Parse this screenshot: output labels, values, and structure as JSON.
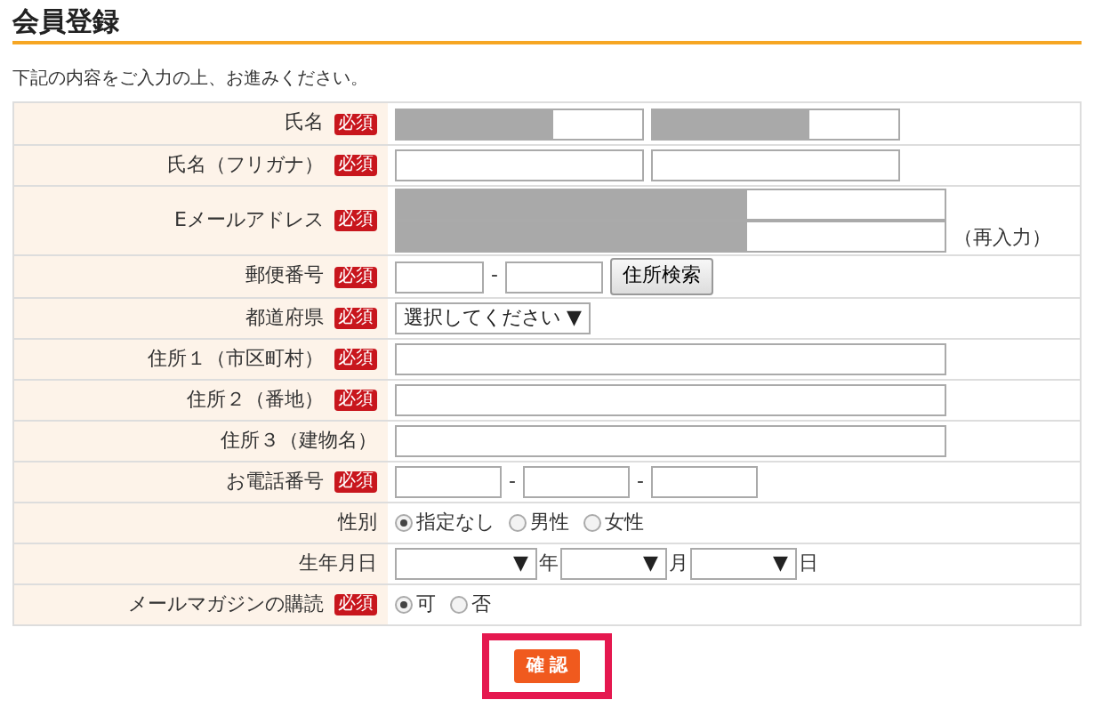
{
  "title": "会員登録",
  "intro": "下記の内容をご入力の上、お進みください。",
  "rows": [
    {
      "kind": "pair",
      "label": "氏名",
      "badge": "必須",
      "fields": [
        {
          "masked": true
        },
        {
          "masked": true
        }
      ]
    },
    {
      "kind": "pair",
      "label": "氏名（フリガナ）",
      "badge": "必須",
      "fields": [
        {
          "masked": false
        },
        {
          "masked": false
        }
      ]
    },
    {
      "kind": "email",
      "label": "Eメールアドレス",
      "badge": "必須",
      "fields": [
        {
          "masked": true
        },
        {
          "masked": true
        }
      ],
      "note": "（再入力）"
    },
    {
      "kind": "postal",
      "label": "郵便番号",
      "badge": "必須",
      "fields": [
        {
          "masked": false
        },
        {
          "masked": false
        }
      ],
      "separator": "-",
      "button": "住所検索"
    },
    {
      "kind": "select",
      "label": "都道府県",
      "badge": "必須",
      "value": "選択してください",
      "caret": "▼"
    },
    {
      "kind": "text",
      "label": "住所１（市区町村）",
      "badge": "必須",
      "fields": [
        {
          "masked": false
        }
      ]
    },
    {
      "kind": "text",
      "label": "住所２（番地）",
      "badge": "必須",
      "fields": [
        {
          "masked": false
        }
      ]
    },
    {
      "kind": "text",
      "label": "住所３（建物名）",
      "fields": [
        {
          "masked": false
        }
      ]
    },
    {
      "kind": "phone",
      "label": "お電話番号",
      "badge": "必須",
      "fields": [
        {
          "masked": false
        },
        {
          "masked": false
        },
        {
          "masked": false
        }
      ],
      "separator": "-"
    },
    {
      "kind": "radio",
      "label": "性別",
      "options": [
        {
          "label": "指定なし",
          "selected": true
        },
        {
          "label": "男性",
          "selected": false
        },
        {
          "label": "女性",
          "selected": false
        }
      ]
    },
    {
      "kind": "date",
      "label": "生年月日",
      "selects": [
        {
          "caret": "▼",
          "unit": "年"
        },
        {
          "caret": "▼",
          "unit": "月"
        },
        {
          "caret": "▼",
          "unit": "日"
        }
      ]
    },
    {
      "kind": "radio",
      "label": "メールマガジンの購読",
      "badge": "必須",
      "options": [
        {
          "label": "可",
          "selected": true
        },
        {
          "label": "否",
          "selected": false
        }
      ]
    }
  ],
  "submit": {
    "label": "確 認",
    "highlighted": true
  }
}
